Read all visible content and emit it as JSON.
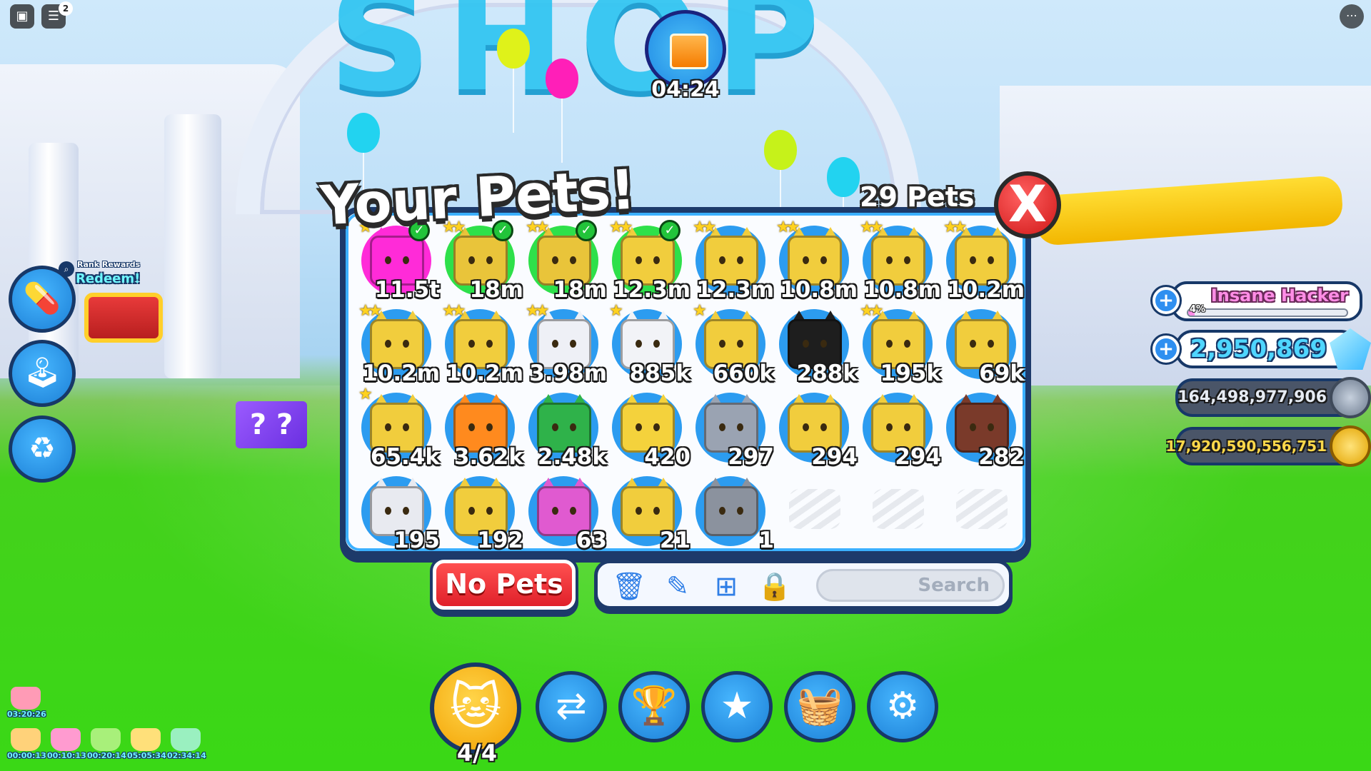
{
  "background": {
    "shop_sign": "SHOP"
  },
  "topbar": {
    "menu_icon": "roblox-menu-icon",
    "chat_icon": "chat-icon",
    "chat_badge": "2",
    "more_icon": "more-icon"
  },
  "gift": {
    "timer": "04:24"
  },
  "pets_window": {
    "title": "Your Pets!",
    "count": "29 Pets",
    "close_label": "X",
    "pets": [
      {
        "value": "11.5t",
        "stars": 1,
        "equipped": true,
        "color": "#ff2bd8",
        "circle": "pink"
      },
      {
        "value": "18m",
        "stars": 2,
        "equipped": true,
        "color": "#e9c43a",
        "circle": "green"
      },
      {
        "value": "18m",
        "stars": 2,
        "equipped": true,
        "color": "#e9c43a",
        "circle": "green"
      },
      {
        "value": "12.3m",
        "stars": 2,
        "equipped": true,
        "color": "#f1cd3d",
        "circle": "green"
      },
      {
        "value": "12.3m",
        "stars": 2,
        "equipped": false,
        "color": "#f1cd3d",
        "circle": "blue"
      },
      {
        "value": "10.8m",
        "stars": 2,
        "equipped": false,
        "color": "#f1cd3d",
        "circle": "blue"
      },
      {
        "value": "10.8m",
        "stars": 2,
        "equipped": false,
        "color": "#f1cd3d",
        "circle": "blue"
      },
      {
        "value": "10.2m",
        "stars": 2,
        "equipped": false,
        "color": "#f1cd3d",
        "circle": "blue"
      },
      {
        "value": "10.2m",
        "stars": 2,
        "equipped": false,
        "color": "#f1cd3d",
        "circle": "blue"
      },
      {
        "value": "10.2m",
        "stars": 2,
        "equipped": false,
        "color": "#f1cd3d",
        "circle": "blue"
      },
      {
        "value": "3.98m",
        "stars": 2,
        "equipped": false,
        "color": "#eef0f6",
        "circle": "blue"
      },
      {
        "value": "885k",
        "stars": 1,
        "equipped": false,
        "color": "#f2f3f7",
        "circle": "blue"
      },
      {
        "value": "660k",
        "stars": 1,
        "equipped": false,
        "color": "#f1cd3d",
        "circle": "blue"
      },
      {
        "value": "288k",
        "stars": 0,
        "equipped": false,
        "color": "#1e1e1e",
        "circle": "blue"
      },
      {
        "value": "195k",
        "stars": 2,
        "equipped": false,
        "color": "#f1cd3d",
        "circle": "blue"
      },
      {
        "value": "69k",
        "stars": 0,
        "equipped": false,
        "color": "#f1cd3d",
        "circle": "blue"
      },
      {
        "value": "65.4k",
        "stars": 1,
        "equipped": false,
        "color": "#f1cd3d",
        "circle": "blue"
      },
      {
        "value": "3.62k",
        "stars": 0,
        "equipped": false,
        "color": "#ff8a1e",
        "circle": "blue"
      },
      {
        "value": "2.48k",
        "stars": 0,
        "equipped": false,
        "color": "#2fb24a",
        "circle": "blue"
      },
      {
        "value": "420",
        "stars": 0,
        "equipped": false,
        "color": "#f4d23c",
        "circle": "blue"
      },
      {
        "value": "297",
        "stars": 0,
        "equipped": false,
        "color": "#9aa3b2",
        "circle": "blue"
      },
      {
        "value": "294",
        "stars": 0,
        "equipped": false,
        "color": "#f1cd3d",
        "circle": "blue"
      },
      {
        "value": "294",
        "stars": 0,
        "equipped": false,
        "color": "#f1cd3d",
        "circle": "blue"
      },
      {
        "value": "282",
        "stars": 0,
        "equipped": false,
        "color": "#7a3a2a",
        "circle": "blue"
      },
      {
        "value": "195",
        "stars": 0,
        "equipped": false,
        "color": "#e8eaf0",
        "circle": "blue"
      },
      {
        "value": "192",
        "stars": 0,
        "equipped": false,
        "color": "#f1cd3d",
        "circle": "blue"
      },
      {
        "value": "63",
        "stars": 0,
        "equipped": false,
        "color": "#e05ad0",
        "circle": "blue"
      },
      {
        "value": "21",
        "stars": 0,
        "equipped": false,
        "color": "#f1cd3d",
        "circle": "blue"
      },
      {
        "value": "1",
        "stars": 0,
        "equipped": false,
        "color": "#8b929e",
        "circle": "blue"
      }
    ],
    "empty_slots": 3
  },
  "toolbar": {
    "no_pets_label": "No Pets",
    "delete_icon": "trash-icon",
    "rename_icon": "pencil-icon",
    "layout_icon": "grid-icon",
    "lock_icon": "lock-icon",
    "search_placeholder": "Search"
  },
  "left_buttons": {
    "rank_rewards_label": "Rank Rewards",
    "rank_redeem_label": "Redeem!",
    "buttons": [
      "potion-icon",
      "joystick-icon",
      "rebirth-icon"
    ]
  },
  "right_panel": {
    "rank_name": "Insane Hacker",
    "rank_percent": "4%",
    "rank_progress": 0.04,
    "diamonds": "2,950,869",
    "silver_coins": "164,498,977,906",
    "gold_coins": "17,920,590,556,751"
  },
  "hotbar": {
    "pet_slots": "4/4",
    "buttons": [
      "pets-icon",
      "trade-icon",
      "trophy-icon",
      "star-icon",
      "shop-basket-icon",
      "settings-icon"
    ]
  },
  "potions": [
    {
      "time": "03:20:26"
    },
    {
      "time": "00:00:13"
    },
    {
      "time": "00:10:13"
    },
    {
      "time": "00:20:14"
    },
    {
      "time": "05:05:34"
    },
    {
      "time": "02:34:14"
    }
  ]
}
